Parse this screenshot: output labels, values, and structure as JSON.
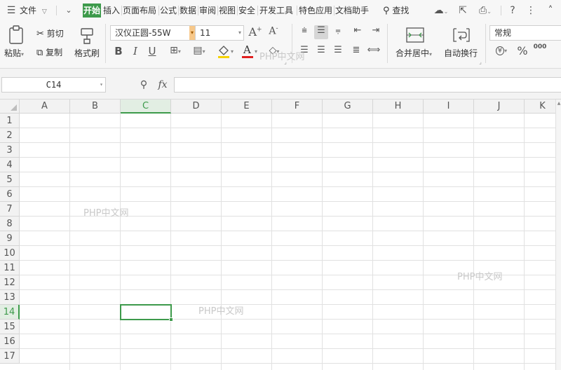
{
  "menubar": {
    "file_label": "文件",
    "tabs": [
      "开始",
      "插入",
      "页面布局",
      "公式",
      "数据",
      "审阅",
      "视图",
      "安全",
      "开发工具",
      "特色应用",
      "文档助手"
    ],
    "active_tab": "开始",
    "search_label": "查找"
  },
  "ribbon": {
    "paste_label": "粘贴",
    "cut_label": "剪切",
    "copy_label": "复制",
    "format_painter_label": "格式刷",
    "font_name": "汉仪正圆-55W",
    "font_size": "11",
    "merge_label": "合并居中",
    "wrap_label": "自动换行",
    "number_format": "常规",
    "bold": "B",
    "italic": "I",
    "underline": "U",
    "percent": "%",
    "increase_font": "A",
    "decrease_font": "A",
    "font_color_glyph": "A",
    "currency_glyph": "¥",
    "decimal_glyph": "000"
  },
  "formula_bar": {
    "name_box": "C14",
    "fx_label": "fx"
  },
  "sheet": {
    "columns": [
      "A",
      "B",
      "C",
      "D",
      "E",
      "F",
      "G",
      "H",
      "I",
      "J",
      "K"
    ],
    "rows": [
      "1",
      "2",
      "3",
      "4",
      "5",
      "6",
      "7",
      "8",
      "9",
      "10",
      "11",
      "12",
      "13",
      "14",
      "15",
      "16",
      "17"
    ],
    "selected_column": "C",
    "selected_row": "14",
    "active_cell": "C14"
  },
  "watermark_text": "PHP中文网",
  "colors": {
    "accent": "#3d9a4b",
    "header_bg": "#f2f2f2",
    "gridline": "#e1e1e1"
  }
}
